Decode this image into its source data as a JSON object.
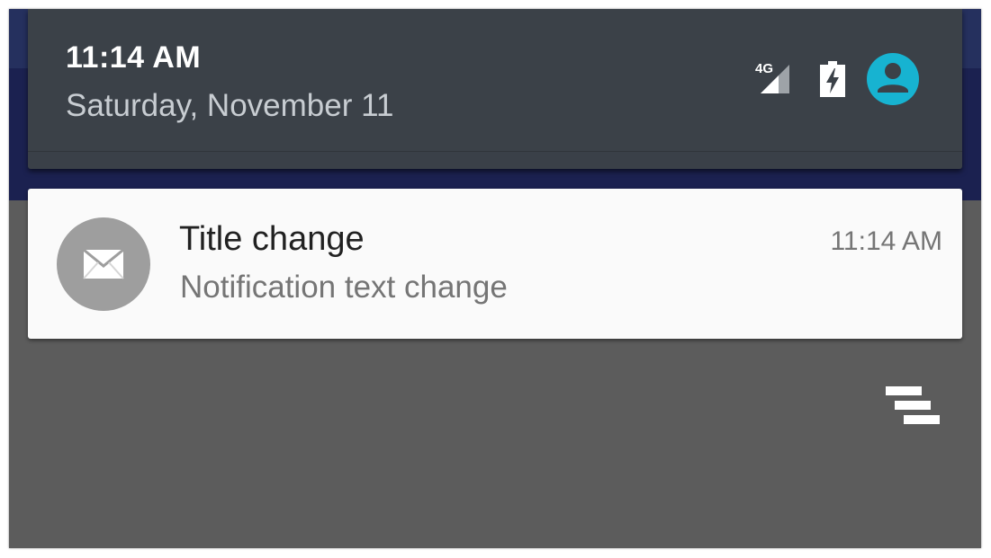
{
  "status_header": {
    "time": "11:14 AM",
    "date": "Saturday, November 11",
    "network_label": "4G",
    "icons": [
      "signal-icon",
      "battery-charging-icon",
      "user-avatar-icon"
    ]
  },
  "notification": {
    "app_icon": "email-icon",
    "title": "Title change",
    "text": "Notification text change",
    "time": "11:14 AM"
  },
  "actions": {
    "clear_all_icon": "clear-all-icon"
  },
  "colors": {
    "panel_background": "#5c5c5c",
    "header_background": "#3b4148",
    "top_band": "#1b2150",
    "notification_card": "#fafafa",
    "notification_icon_bg": "#9e9e9e",
    "avatar_accent": "#17b3d1",
    "title_text": "#212121",
    "secondary_text": "#757575"
  }
}
